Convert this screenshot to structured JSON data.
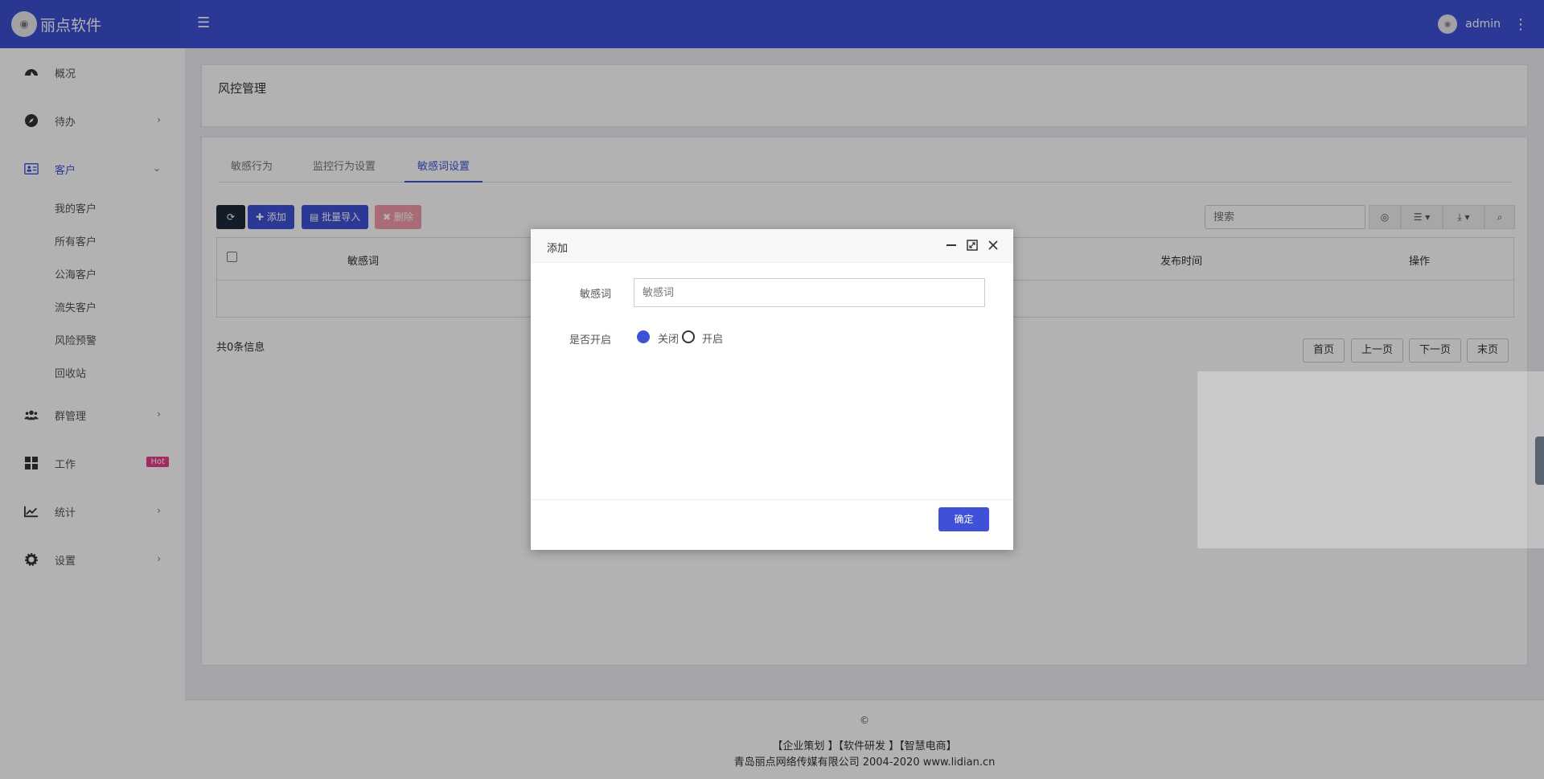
{
  "brand": {
    "name": "丽点软件"
  },
  "header": {
    "username": "admin"
  },
  "sidebar": {
    "items": [
      {
        "label": "概况"
      },
      {
        "label": "待办"
      },
      {
        "label": "客户"
      },
      {
        "label": "群管理"
      },
      {
        "label": "工作",
        "badge": "Hot"
      },
      {
        "label": "统计"
      },
      {
        "label": "设置"
      }
    ],
    "customer_sub": [
      "我的客户",
      "所有客户",
      "公海客户",
      "流失客户",
      "风险预警",
      "回收站"
    ]
  },
  "page": {
    "title": "风控管理"
  },
  "tabs": [
    "敏感行为",
    "监控行为设置",
    "敏感词设置"
  ],
  "toolbar": {
    "add_label": "添加",
    "import_label": "批量导入",
    "delete_label": "删除",
    "search_placeholder": "搜索"
  },
  "table": {
    "headers": [
      "敏感词",
      "发布时间",
      "操作"
    ],
    "total": "共0条信息"
  },
  "pager": [
    "首页",
    "上一页",
    "下一页",
    "末页"
  ],
  "footer": {
    "copyright": "©",
    "links": "【企业策划 】【软件研发 】【智慧电商】",
    "company": "青岛丽点网络传媒有限公司 2004-2020 www.lidian.cn"
  },
  "modal": {
    "title": "添加",
    "field_label": "敏感词",
    "field_placeholder": "敏感词",
    "switch_label": "是否开启",
    "option_off": "关闭",
    "option_on": "开启",
    "confirm": "确定"
  },
  "colors": {
    "primary": "#3f51d6",
    "danger": "#e83e8c",
    "dark": "#1d2939"
  }
}
